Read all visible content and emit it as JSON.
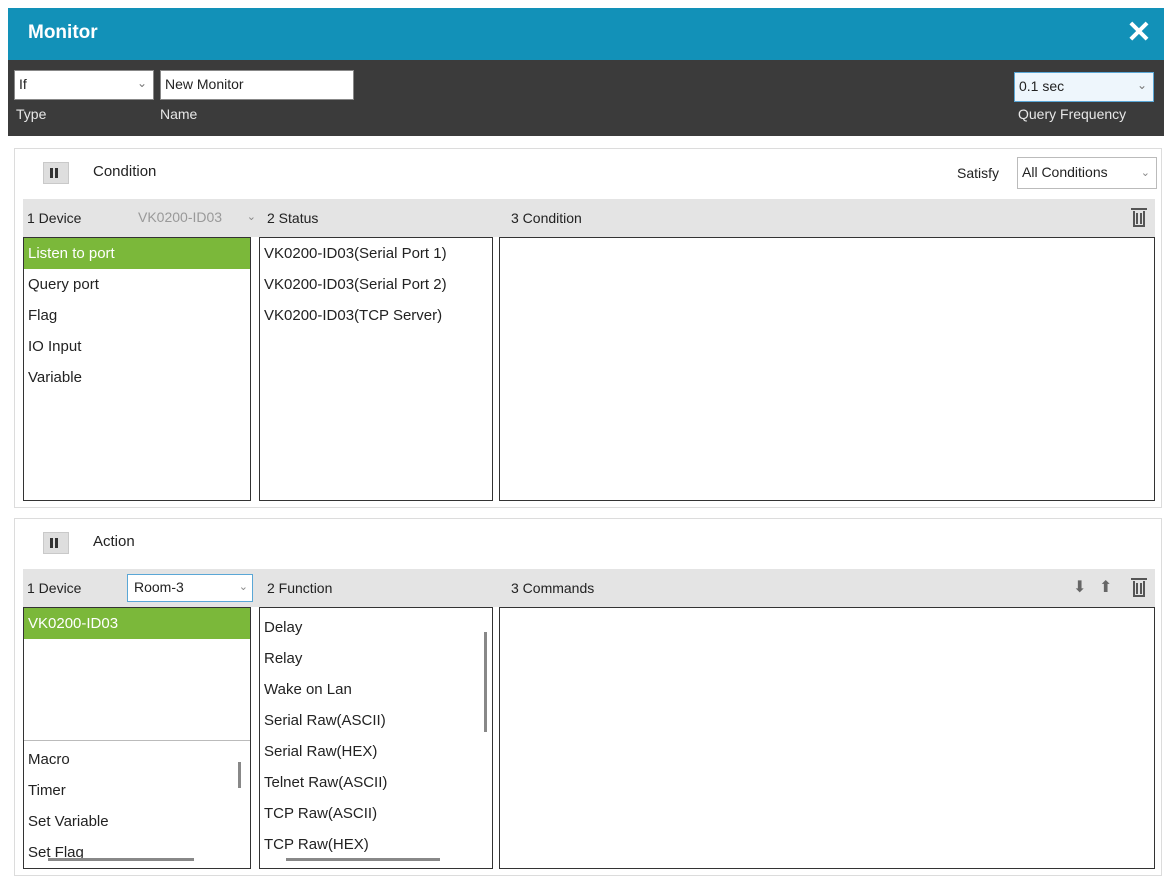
{
  "window": {
    "title": "Monitor"
  },
  "toolbar": {
    "type_value": "If",
    "type_label": "Type",
    "name_value": "New Monitor",
    "name_label": "Name",
    "freq_value": "0.1 sec",
    "freq_label": "Query Frequency"
  },
  "condition": {
    "title": "Condition",
    "satisfy_label": "Satisfy",
    "satisfy_value": "All Conditions",
    "col1_label": "1  Device",
    "device_value": "VK0200-ID03",
    "col2_label": "2  Status",
    "col3_label": "3  Condition",
    "device_items": [
      "Listen to port",
      "Query port",
      "Flag",
      "IO Input",
      "Variable"
    ],
    "status_items": [
      "VK0200-ID03(Serial Port 1)",
      "VK0200-ID03(Serial Port 2)",
      "VK0200-ID03(TCP Server)"
    ]
  },
  "action": {
    "title": "Action",
    "col1_label": "1  Device",
    "device_value": "Room-3",
    "col2_label": "2  Function",
    "col3_label": "3  Commands",
    "device_items": [
      "VK0200-ID03"
    ],
    "extra_items": [
      "Macro",
      "Timer",
      "Set Variable",
      "Set Flag"
    ],
    "function_items": [
      "Delay",
      "Relay",
      "Wake on Lan",
      "Serial Raw(ASCII)",
      "Serial Raw(HEX)",
      "Telnet Raw(ASCII)",
      "TCP Raw(ASCII)",
      "TCP Raw(HEX)"
    ]
  },
  "colors": {
    "titlebar": "#1291b8",
    "toolbar": "#3b3b3b",
    "selection": "#7bb83a"
  }
}
